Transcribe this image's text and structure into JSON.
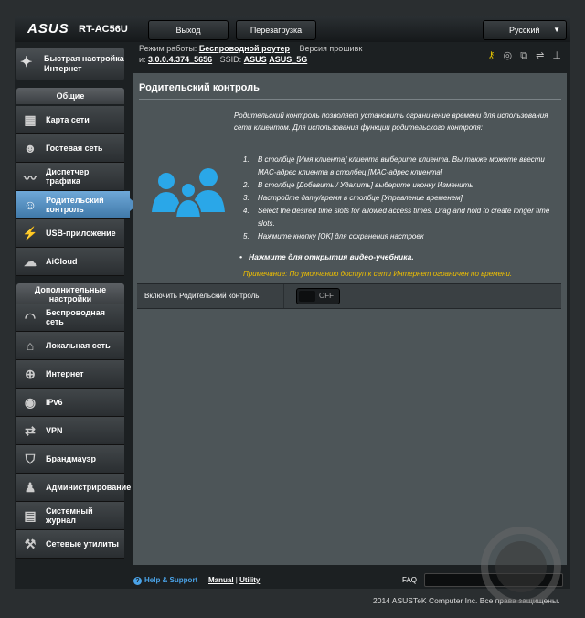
{
  "header": {
    "brand": "ASUS",
    "model": "RT-AC56U",
    "logout_label": "Выход",
    "reboot_label": "Перезагрузка",
    "language": "Русский"
  },
  "info": {
    "mode_label": "Режим работы:",
    "mode_value": "Беспроводной роутер",
    "firmware_label": "Версия прошивк",
    "firmware_prefix": "и:",
    "firmware_value": "3.0.0.4.374_5656",
    "ssid_label": "SSID:",
    "ssid_1": "ASUS",
    "ssid_2": "ASUS_5G"
  },
  "sidebar": {
    "quick_setup": "Быстрая настройка Интернет",
    "general_header": "Общие",
    "general_items": [
      {
        "label": "Карта сети",
        "icon": "network-map-icon"
      },
      {
        "label": "Гостевая сеть",
        "icon": "guest-network-icon"
      },
      {
        "label": "Диспетчер трафика",
        "icon": "traffic-manager-icon"
      },
      {
        "label": "Родительский контроль",
        "icon": "parental-control-icon"
      },
      {
        "label": "USB-приложение",
        "icon": "usb-icon"
      },
      {
        "label": "AiCloud",
        "icon": "cloud-icon"
      }
    ],
    "advanced_header": "Дополнительные настройки",
    "advanced_items": [
      {
        "label": "Беспроводная сеть",
        "icon": "wireless-icon"
      },
      {
        "label": "Локальная сеть",
        "icon": "lan-icon"
      },
      {
        "label": "Интернет",
        "icon": "globe-icon"
      },
      {
        "label": "IPv6",
        "icon": "ipv6-icon"
      },
      {
        "label": "VPN",
        "icon": "vpn-icon"
      },
      {
        "label": "Брандмауэр",
        "icon": "firewall-icon"
      },
      {
        "label": "Администрирование",
        "icon": "admin-icon"
      },
      {
        "label": "Системный журнал",
        "icon": "syslog-icon"
      },
      {
        "label": "Сетевые утилиты",
        "icon": "tools-icon"
      }
    ]
  },
  "main": {
    "title": "Родительский контроль",
    "description": "Родительский контроль позволяет установить ограничение времени для использования сети клиентом. Для использования функции родительского контроля:",
    "steps": [
      "В столбце [Имя клиента] клиента выберите клиента. Вы также можете ввести MAC-адрес клиента в столбец [MAC-адрес клиента]",
      "В столбце [Добавить / Удалить] выберите иконку Изменить",
      "Настройте дату/время в столбце [Управление временем]",
      "Select the desired time slots for allowed access times. Drag and hold to create longer time slots.",
      "Нажмите кнопку [OK] для сохранения настроек"
    ],
    "video_link": "Нажмите для открытия видео-учебника.",
    "note": "Примечание: По умолчанию доступ к сети Интернет ограничен по времени.",
    "toggle_label": "Включить Родительский контроль",
    "toggle_state": "OFF"
  },
  "footer": {
    "help": "Help & Support",
    "manual": "Manual",
    "utility": "Utility",
    "faq": "FAQ",
    "copyright": "2014 ASUSTeK Computer Inc. Все права защищены."
  }
}
